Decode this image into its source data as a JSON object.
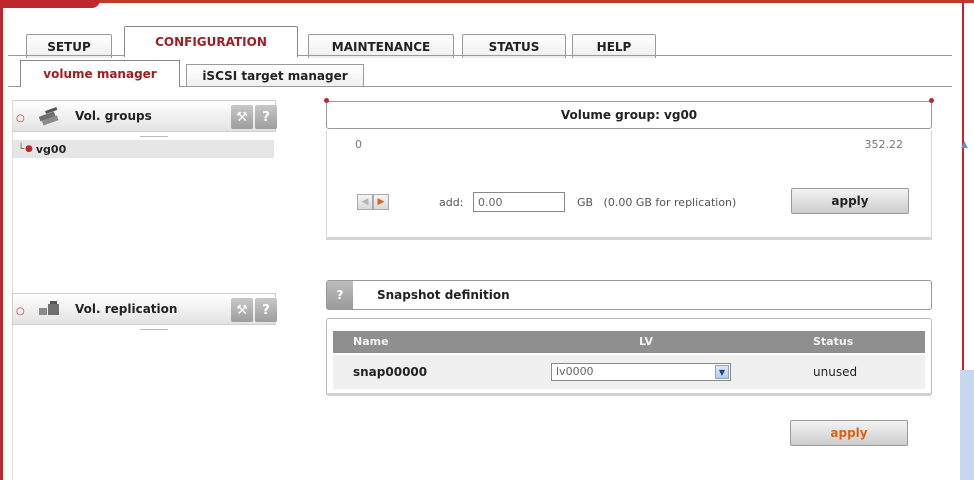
{
  "main_tabs": [
    "SETUP",
    "CONFIGURATION",
    "MAINTENANCE",
    "STATUS",
    "HELP"
  ],
  "active_main_tab": "CONFIGURATION",
  "sub_tabs": [
    "volume manager",
    "iSCSI target manager"
  ],
  "active_sub_tab": "volume manager",
  "left_panel": {
    "vol_groups": {
      "title": "Vol. groups",
      "tool_icon": "wrench-icon",
      "help_label": "?"
    },
    "groups": [
      "vg00"
    ],
    "vol_replication": {
      "title": "Vol. replication",
      "tool_icon": "wrench-icon",
      "help_label": "?"
    }
  },
  "volume_group": {
    "title": "Volume group: vg00",
    "scale_min": "0",
    "scale_max": "352.22",
    "add_label": "add:",
    "add_value": "0.00",
    "unit_note": "GB   (0.00 GB for replication)",
    "apply_label": "apply"
  },
  "snapshot": {
    "help_label": "?",
    "title": "Snapshot definition",
    "columns": {
      "name": "Name",
      "lv": "LV",
      "status": "Status"
    },
    "rows": [
      {
        "name": "snap00000",
        "lv": "lv0000",
        "status": "unused"
      }
    ],
    "apply_label": "apply"
  },
  "colors": {
    "accent": "#c0272d",
    "active_tab_text": "#a01d22",
    "apply_orange": "#e0600f",
    "table_header": "#8f8f8f"
  }
}
